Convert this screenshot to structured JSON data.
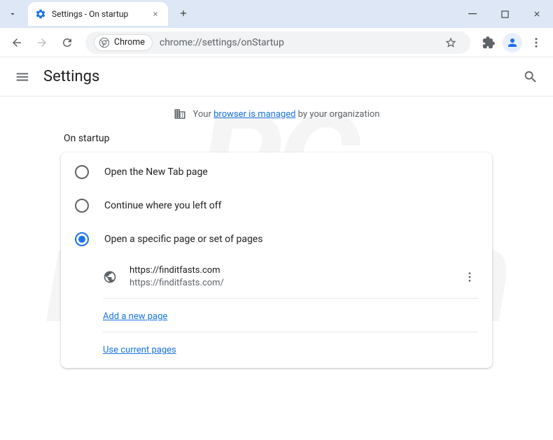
{
  "tab": {
    "title": "Settings - On startup"
  },
  "omnibox": {
    "chip": "Chrome",
    "url": "chrome://settings/onStartup"
  },
  "settings": {
    "title": "Settings"
  },
  "managed": {
    "prefix": "Your ",
    "link": "browser is managed",
    "suffix": " by your organization"
  },
  "section": {
    "title": "On startup"
  },
  "options": {
    "opt1": "Open the New Tab page",
    "opt2": "Continue where you left off",
    "opt3": "Open a specific page or set of pages"
  },
  "page": {
    "title": "https://finditfasts.com",
    "url": "https://finditfasts.com/"
  },
  "links": {
    "add": "Add a new page",
    "current": "Use current pages"
  }
}
